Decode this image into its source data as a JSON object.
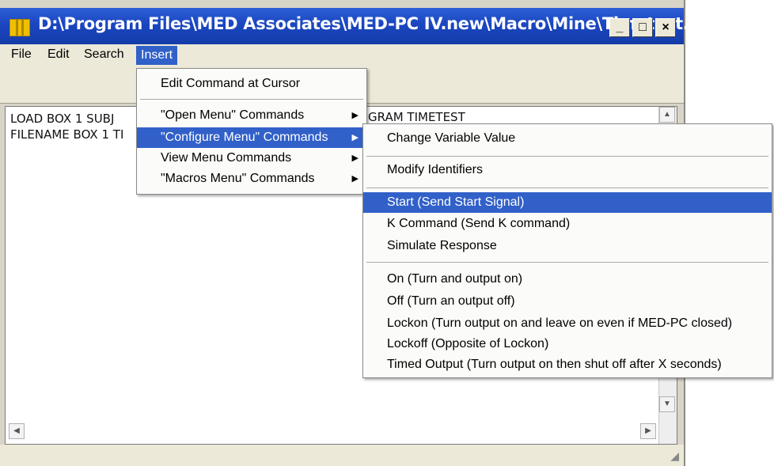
{
  "window": {
    "title": "D:\\Program Files\\MED Associates\\MED-PC IV.new\\Macro\\Mine\\Timetest....",
    "minimize_label": "_",
    "maximize_label": "□",
    "close_label": "×",
    "app_icon": "bar-chart-icon"
  },
  "menubar": {
    "items": [
      {
        "label": "File"
      },
      {
        "label": "Edit"
      },
      {
        "label": "Search"
      },
      {
        "label": "Insert"
      }
    ]
  },
  "editor": {
    "lines": [
      "LOAD BOX 1 SUBJ",
      "FILENAME BOX 1 TI"
    ],
    "hidden_fragment": "GRAM TIMETEST"
  },
  "insert_menu": {
    "items": [
      {
        "label": "Edit Command at Cursor",
        "submenu": false
      },
      {
        "label": "\"Open Menu\" Commands",
        "submenu": true
      },
      {
        "label": "\"Configure Menu\" Commands",
        "submenu": true,
        "highlighted": true
      },
      {
        "label": "View Menu Commands",
        "submenu": true
      },
      {
        "label": "\"Macros Menu\" Commands",
        "submenu": true
      }
    ]
  },
  "configure_submenu": {
    "items": [
      {
        "label": "Change Variable Value"
      },
      {
        "label": "Modify Identifiers"
      },
      {
        "label": "Start (Send Start Signal)",
        "highlighted": true
      },
      {
        "label": "K Command (Send K command)"
      },
      {
        "label": "Simulate Response"
      },
      {
        "label": "On (Turn and output on)"
      },
      {
        "label": "Off (Turn an output off)"
      },
      {
        "label": "Lockon (Turn output on and leave on even if MED-PC closed)"
      },
      {
        "label": "Lockoff (Opposite of Lockon)"
      },
      {
        "label": "Timed Output (Turn output on then shut off after X seconds)"
      }
    ]
  },
  "colors": {
    "title_bar": "#1a46c0",
    "highlight": "#3160c9",
    "chrome": "#ece9d8"
  }
}
